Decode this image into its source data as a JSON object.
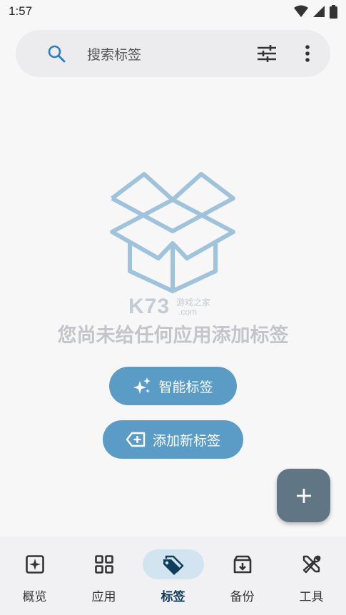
{
  "status_bar": {
    "time": "1:57"
  },
  "search": {
    "placeholder": "搜索标签"
  },
  "empty_state": {
    "watermark": {
      "brand": "K73",
      "sub": "游戏之家",
      "url": ".com"
    },
    "message": "您尚未给任何应用添加标签"
  },
  "actions": {
    "smart_tags_label": "智能标签",
    "add_tag_label": "添加新标签"
  },
  "bottom_nav": {
    "items": [
      {
        "label": "概览",
        "icon": "overview-icon",
        "active": false
      },
      {
        "label": "应用",
        "icon": "apps-grid-icon",
        "active": false
      },
      {
        "label": "标签",
        "icon": "tags-icon",
        "active": true
      },
      {
        "label": "备份",
        "icon": "archive-icon",
        "active": false
      },
      {
        "label": "工具",
        "icon": "tools-icon",
        "active": false
      }
    ]
  },
  "colors": {
    "accent": "#5b9cc7",
    "fab": "#607685",
    "active_nav_bg": "#d3e4f1",
    "illustration": "#9ec3da"
  }
}
